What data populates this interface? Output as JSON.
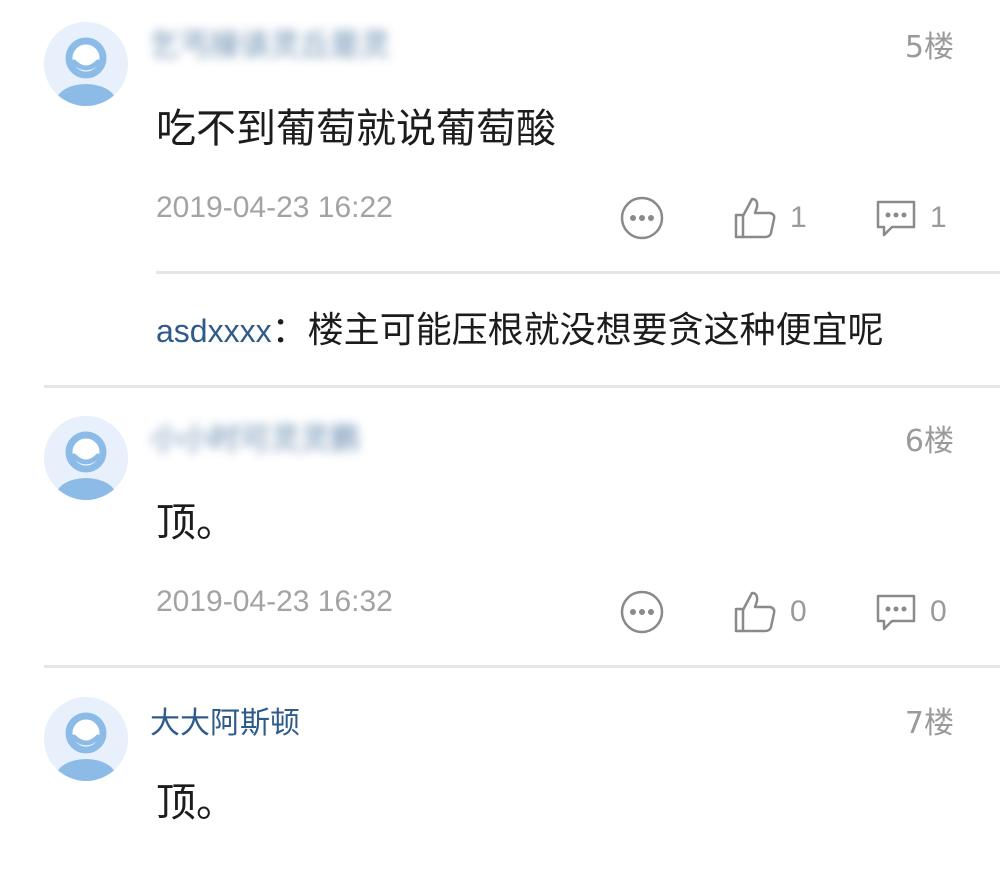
{
  "comments": [
    {
      "username": "乞丐接该灵丘是灵",
      "floor": "5楼",
      "content": "吃不到葡萄就说葡萄酸",
      "time": "2019-04-23 16:22",
      "likes": "1",
      "replies": "1",
      "reply": {
        "user": "asdxxxx",
        "sep": "：",
        "text": "楼主可能压根就没想要贪这种便宜呢"
      }
    },
    {
      "username": "小小时可灵灵鹏",
      "floor": "6楼",
      "content": "顶。",
      "time": "2019-04-23 16:32",
      "likes": "0",
      "replies": "0"
    },
    {
      "username": "大大阿斯顿",
      "floor": "7楼",
      "content": "顶。"
    }
  ],
  "icons": {
    "more": "more-icon",
    "like": "thumb-up-icon",
    "reply": "comment-icon",
    "avatar": "default-avatar-icon"
  },
  "colors": {
    "username": "#2f5b8a",
    "muted": "#9a9a9a",
    "divider": "#e6e6e6",
    "avatar_bg": "#e8f1fb",
    "avatar_fg": "#7fb2e5"
  }
}
